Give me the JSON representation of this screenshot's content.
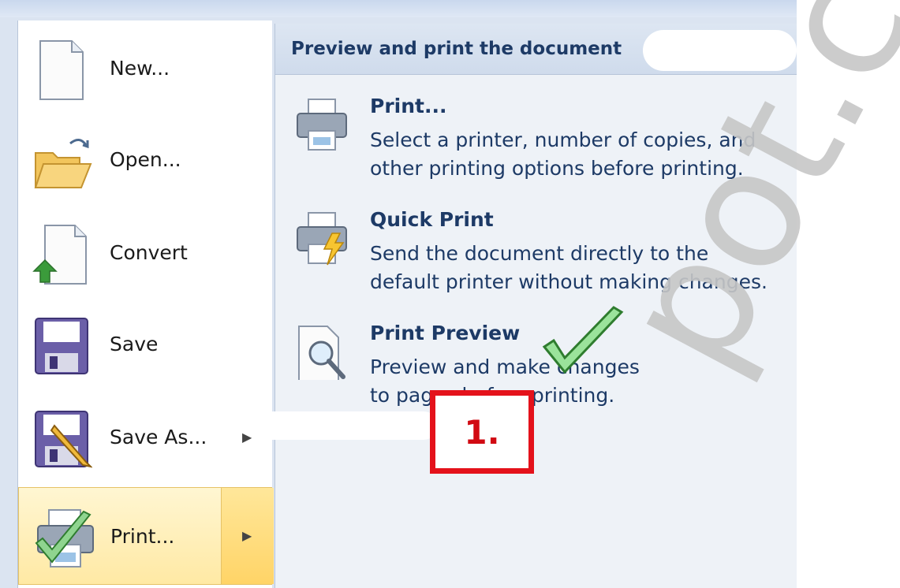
{
  "left_menu": {
    "items": [
      {
        "label": "New...",
        "icon": "new-document-icon",
        "has_arrow": false
      },
      {
        "label": "Open...",
        "icon": "open-folder-icon",
        "has_arrow": false
      },
      {
        "label": "Convert",
        "icon": "convert-icon",
        "has_arrow": false
      },
      {
        "label": "Save",
        "icon": "save-floppy-icon",
        "has_arrow": false
      },
      {
        "label": "Save As...",
        "icon": "save-as-icon",
        "has_arrow": true
      },
      {
        "label": "Print...",
        "icon": "printer-icon",
        "has_arrow": true,
        "selected": true
      }
    ]
  },
  "panel": {
    "title": "Preview and print the document",
    "options": [
      {
        "name": "Print...",
        "description": "Select a printer, number of copies, and\nother printing options before printing.",
        "icon": "printer-icon"
      },
      {
        "name": "Quick Print",
        "description": "Send the document directly to the\ndefault printer without making changes.",
        "icon": "quick-print-icon"
      },
      {
        "name": "Print Preview",
        "description": "Preview and make changes\nto pages before printing.",
        "icon": "print-preview-icon"
      }
    ]
  },
  "annotation": {
    "step_label": "1."
  },
  "watermark": {
    "text": "pot.co"
  },
  "colors": {
    "accent_text": "#1d3a66",
    "highlight": "#ffe9a4",
    "annotation_red": "#e4121b",
    "check_green": "#5cb85c"
  }
}
